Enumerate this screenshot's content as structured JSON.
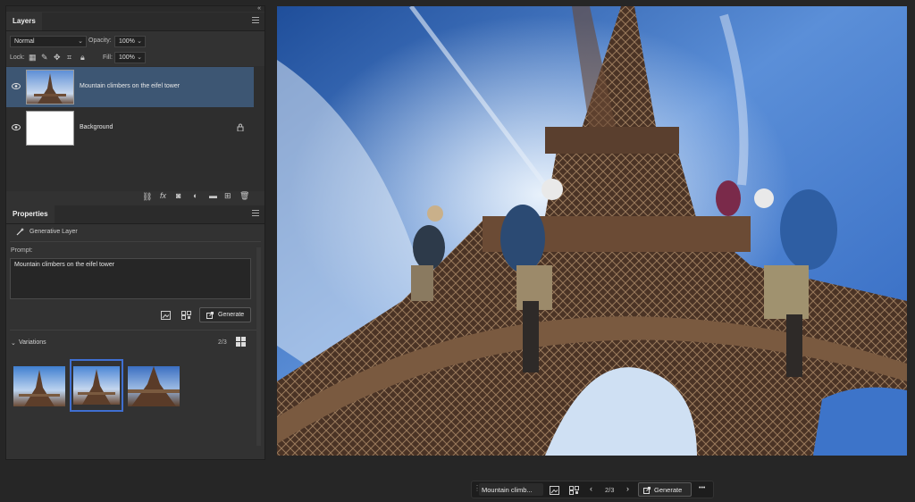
{
  "layers_panel": {
    "tab_label": "Layers",
    "blend_mode": "Normal",
    "opacity_label": "Opacity:",
    "opacity_value": "100%",
    "lock_label": "Lock:",
    "fill_label": "Fill:",
    "fill_value": "100%",
    "layers": [
      {
        "name": "Mountain climbers on the eifel tower",
        "visible": true,
        "selected": true,
        "locked": false
      },
      {
        "name": "Background",
        "visible": true,
        "selected": false,
        "locked": true
      }
    ],
    "footer_icons": [
      "link-icon",
      "fx-icon",
      "mask-icon",
      "adjustment-icon",
      "folder-icon",
      "new-layer-icon",
      "trash-icon"
    ]
  },
  "properties_panel": {
    "tab_label": "Properties",
    "layer_type": "Generative Layer",
    "prompt_label": "Prompt:",
    "prompt_value": "Mountain climbers on the eifel tower",
    "generate_label": "Generate",
    "variations_label": "Variations",
    "variations_count": "2/3",
    "variations_selected_index": 1
  },
  "contextual_bar": {
    "prompt_text": "Mountain climb...",
    "page": "2/3",
    "generate_label": "Generate",
    "more_label": "•••"
  },
  "colors": {
    "accent_selected_row": "#3d5673",
    "variation_border": "#3f6fd1",
    "panel_bg": "#323232",
    "app_bg": "#262626"
  }
}
